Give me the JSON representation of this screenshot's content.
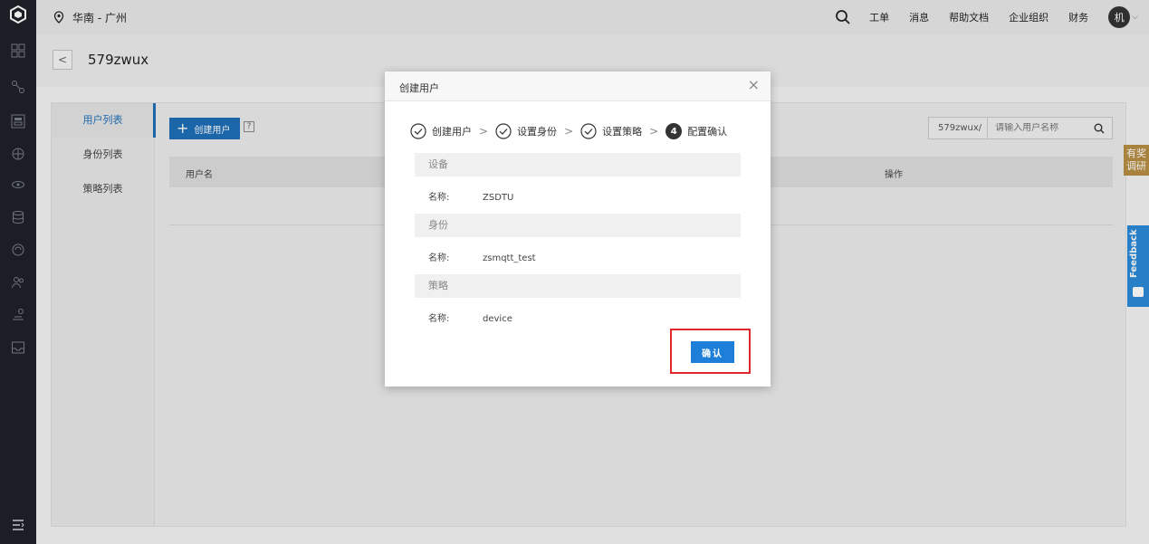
{
  "topbar": {
    "region": "华南 - 广州",
    "links": [
      "工单",
      "消息",
      "帮助文档",
      "企业组织",
      "财务"
    ],
    "avatar": "机"
  },
  "breadcrumb": {
    "title": "579zwux"
  },
  "subnav": {
    "items": [
      {
        "label": "用户列表",
        "active": true
      },
      {
        "label": "身份列表",
        "active": false
      },
      {
        "label": "策略列表",
        "active": false
      }
    ]
  },
  "toolbar": {
    "create_label": "创建用户",
    "help": "?"
  },
  "search": {
    "prefix": "579zwux/",
    "placeholder": "请输入用户名称"
  },
  "table": {
    "columns": [
      "用户名",
      "操作"
    ]
  },
  "side_widgets": {
    "survey": "有奖调研",
    "feedback": "Feedback"
  },
  "modal": {
    "title": "创建用户",
    "steps": [
      {
        "label": "创建用户",
        "state": "done"
      },
      {
        "label": "设置身份",
        "state": "done"
      },
      {
        "label": "设置策略",
        "state": "done"
      },
      {
        "label": "配置确认",
        "state": "current",
        "num": "4"
      }
    ],
    "sections": [
      {
        "heading": "设备",
        "key": "名称:",
        "value": "ZSDTU"
      },
      {
        "heading": "身份",
        "key": "名称:",
        "value": "zsmqtt_test"
      },
      {
        "heading": "策略",
        "key": "名称:",
        "value": "device"
      }
    ],
    "confirm_label": "确认"
  },
  "colors": {
    "primary": "#1e6fb8",
    "highlight": "#e0262b",
    "rail": "#1e2229"
  }
}
